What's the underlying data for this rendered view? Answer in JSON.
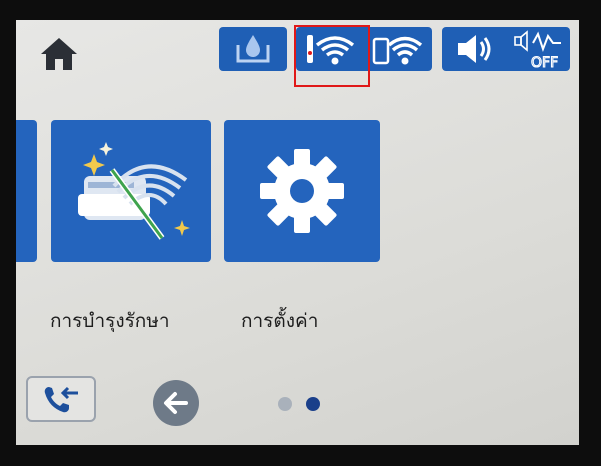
{
  "colors": {
    "tile_blue": "#2464bd",
    "status_blue": "#1f5fb5",
    "highlight_red": "#e01818",
    "dot_inactive": "#a9b1bb",
    "dot_active": "#1a3f8a"
  },
  "top_bar": {
    "home_icon": "home-icon",
    "status_icons": [
      "ink-level-icon",
      "wifi-icon",
      "wifi-direct-icon",
      "sound-icon",
      "quiet-mode-off-icon"
    ],
    "quiet_mode_text": "OFF"
  },
  "tiles": [
    {
      "label": "",
      "icon": "partial-tile"
    },
    {
      "label": "การบำรุงรักษา",
      "icon": "maintenance-icon"
    },
    {
      "label": "การตั้งค่า",
      "icon": "gear-icon"
    }
  ],
  "bottom_bar": {
    "fax_icon": "fax-redial-icon",
    "back_icon": "back-arrow-icon",
    "page_count": 2,
    "current_page": 2
  }
}
